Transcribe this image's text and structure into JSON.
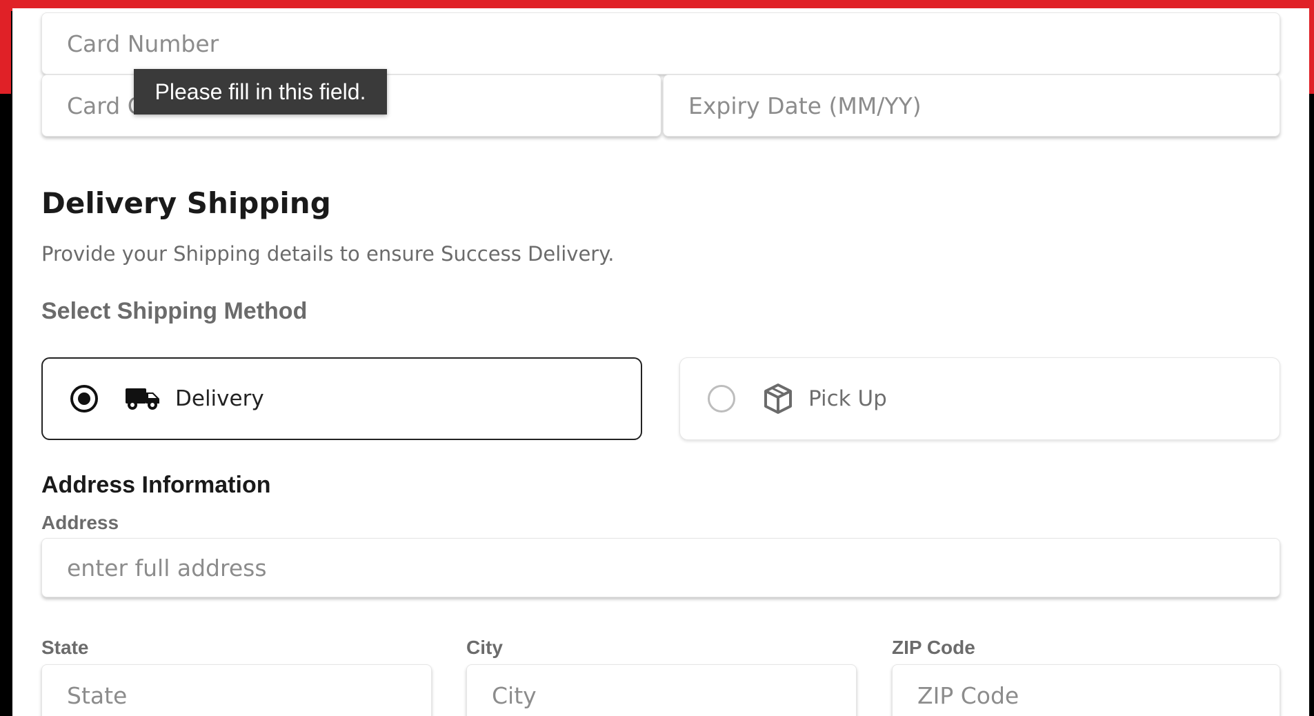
{
  "payment": {
    "card_number_placeholder": "Card Number",
    "card_cvv_placeholder": "Card CVV",
    "expiry_placeholder": "Expiry Date (MM/YY)",
    "validation_tooltip": "Please fill in this field."
  },
  "shipping": {
    "title": "Delivery Shipping",
    "subtitle": "Provide your Shipping details to ensure Success Delivery.",
    "method_label": "Select Shipping Method",
    "options": [
      {
        "label": "Delivery",
        "icon": "truck-icon",
        "selected": true
      },
      {
        "label": "Pick Up",
        "icon": "box-icon",
        "selected": false
      }
    ]
  },
  "address": {
    "heading": "Address Information",
    "address_label": "Address",
    "address_placeholder": "enter full address",
    "state_label": "State",
    "state_placeholder": "State",
    "city_label": "City",
    "city_placeholder": "City",
    "zip_label": "ZIP Code",
    "zip_placeholder": "ZIP Code"
  },
  "colors": {
    "frame_accent": "#e02127",
    "tooltip_bg": "#3a3a3a"
  }
}
